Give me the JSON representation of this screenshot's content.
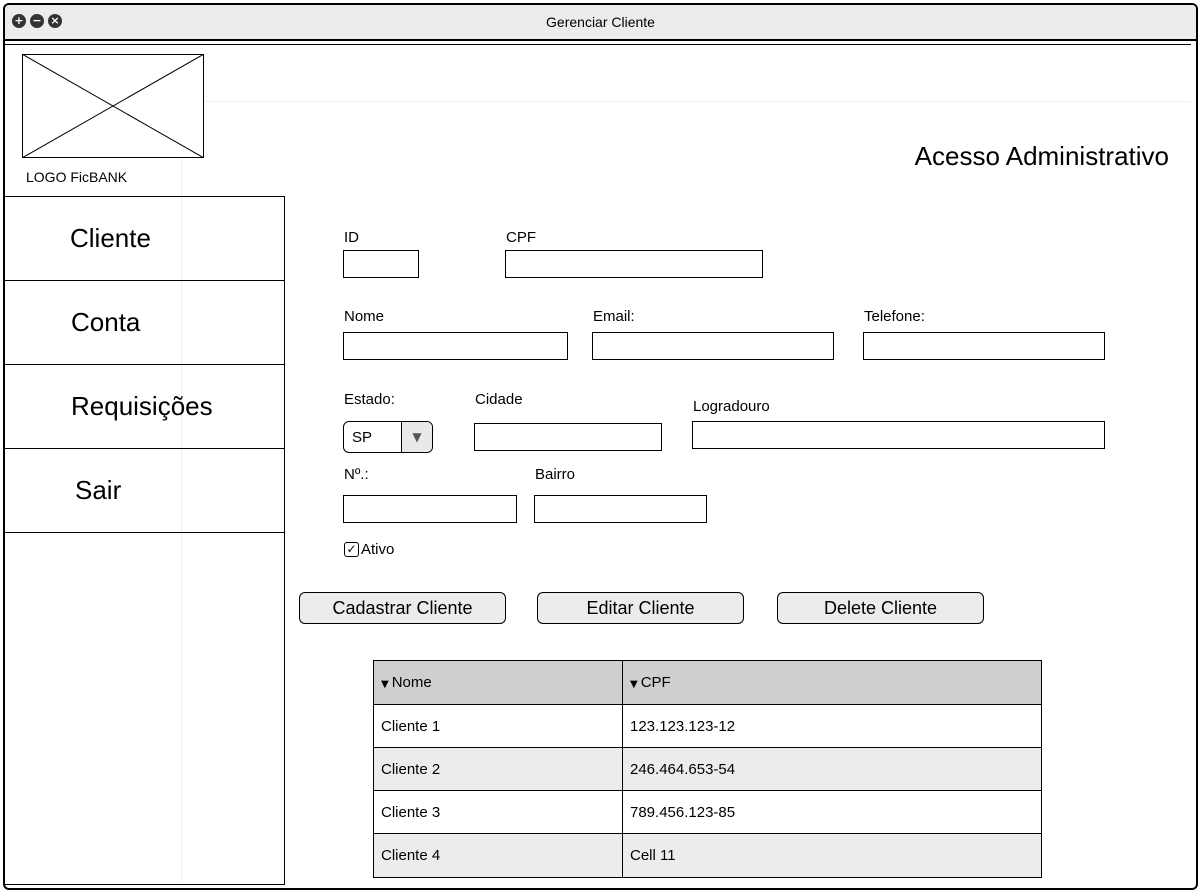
{
  "window": {
    "title": "Gerenciar Cliente",
    "controls": [
      "+",
      "−",
      "×"
    ]
  },
  "header": {
    "logo_label": "LOGO FicBANK",
    "title": "Acesso Administrativo"
  },
  "sidebar": {
    "items": [
      {
        "label": "Cliente"
      },
      {
        "label": "Conta"
      },
      {
        "label": "Requisições"
      },
      {
        "label": "Sair"
      }
    ]
  },
  "form": {
    "id_label": "ID",
    "cpf_label": "CPF",
    "nome_label": "Nome",
    "email_label": "Email:",
    "telefone_label": "Telefone:",
    "estado_label": "Estado:",
    "estado_value": "SP",
    "cidade_label": "Cidade",
    "logradouro_label": "Logradouro",
    "numero_label": "Nº.:",
    "bairro_label": "Bairro",
    "ativo_label": "Ativo",
    "ativo_checked": true
  },
  "buttons": {
    "cadastrar": "Cadastrar Cliente",
    "editar": "Editar Cliente",
    "delete": "Delete Cliente"
  },
  "table": {
    "columns": [
      "Nome",
      "CPF"
    ],
    "rows": [
      [
        "Cliente 1",
        "123.123.123-12"
      ],
      [
        "Cliente 2",
        "246.464.653-54"
      ],
      [
        "Cliente 3",
        "789.456.123-85"
      ],
      [
        "Cliente 4",
        "Cell 11"
      ]
    ]
  }
}
